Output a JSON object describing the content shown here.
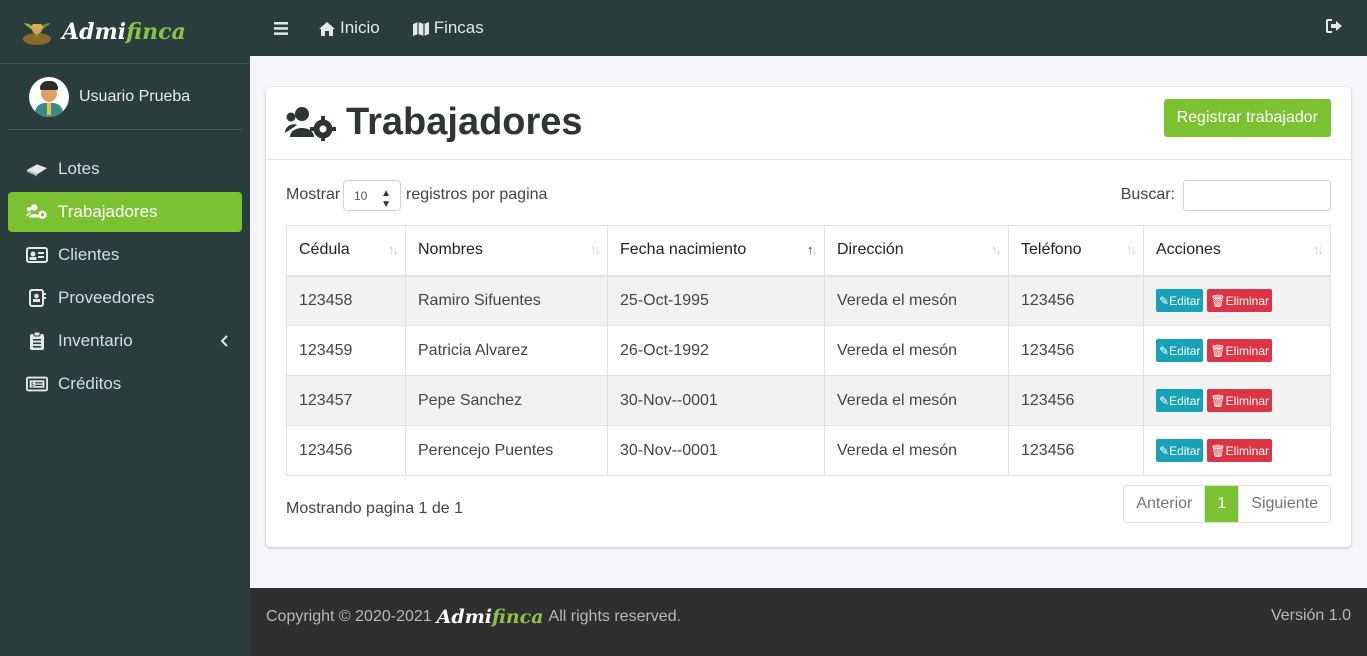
{
  "brand": {
    "name_part1": "Admi",
    "name_part2": "finca"
  },
  "user": {
    "name": "Usuario Prueba"
  },
  "sidebar": {
    "items": [
      {
        "label": "Lotes",
        "icon": "map-book-icon"
      },
      {
        "label": "Trabajadores",
        "icon": "users-cog-icon",
        "active": true
      },
      {
        "label": "Clientes",
        "icon": "address-card-icon"
      },
      {
        "label": "Proveedores",
        "icon": "address-book-icon"
      },
      {
        "label": "Inventario",
        "icon": "clipboard-icon",
        "has_submenu": true
      },
      {
        "label": "Créditos",
        "icon": "money-bill-icon"
      }
    ]
  },
  "topbar": {
    "home_label": "Inicio",
    "farms_label": "Fincas"
  },
  "page": {
    "title": "Trabajadores",
    "register_button": "Registrar trabajador"
  },
  "table_controls": {
    "show_prefix": "Mostrar",
    "page_size": "10",
    "show_suffix": "registros por pagina",
    "search_label": "Buscar:"
  },
  "table": {
    "columns": [
      "Cédula",
      "Nombres",
      "Fecha nacimiento",
      "Dirección",
      "Teléfono",
      "Acciones"
    ],
    "rows": [
      {
        "cedula": "123458",
        "nombres": "Ramiro Sifuentes",
        "fecha": "25-Oct-1995",
        "direccion": "Vereda el mesón",
        "telefono": "123456"
      },
      {
        "cedula": "123459",
        "nombres": "Patricia Alvarez",
        "fecha": "26-Oct-1992",
        "direccion": "Vereda el mesón",
        "telefono": "123456"
      },
      {
        "cedula": "123457",
        "nombres": "Pepe Sanchez",
        "fecha": "30-Nov--0001",
        "direccion": "Vereda el mesón",
        "telefono": "123456"
      },
      {
        "cedula": "123456",
        "nombres": "Perencejo Puentes",
        "fecha": "30-Nov--0001",
        "direccion": "Vereda el mesón",
        "telefono": "123456"
      }
    ],
    "edit_label": "Editar",
    "delete_label": "Eliminar"
  },
  "pagination": {
    "info": "Mostrando pagina 1 de 1",
    "prev": "Anterior",
    "current": "1",
    "next": "Siguiente"
  },
  "footer": {
    "copyright": "Copyright © 2020-2021",
    "rights": "All rights reserved.",
    "version": "Versión 1.0"
  },
  "colors": {
    "sidebar_bg": "#2a3d3d",
    "accent": "#7cc132",
    "edit": "#17a2b8",
    "delete": "#dc3545"
  }
}
